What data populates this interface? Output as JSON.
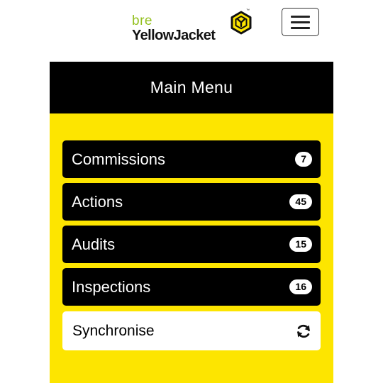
{
  "header": {
    "logo_sub": "bre",
    "logo_main": "YellowJacket",
    "logo_tm": "™",
    "logo_mark_icon": "yellowjacket-hexagon-icon",
    "menu_toggle_icon": "hamburger-menu-icon"
  },
  "main_menu": {
    "title": "Main Menu",
    "items": [
      {
        "label": "Commissions",
        "count": "7"
      },
      {
        "label": "Actions",
        "count": "45"
      },
      {
        "label": "Audits",
        "count": "15"
      },
      {
        "label": "Inspections",
        "count": "16"
      }
    ],
    "sync": {
      "label": "Synchronise",
      "icon": "sync-icon"
    }
  },
  "colors": {
    "accent_yellow": "#fde500",
    "logo_green": "#93c01f",
    "dark": "#000000",
    "light": "#ffffff"
  }
}
